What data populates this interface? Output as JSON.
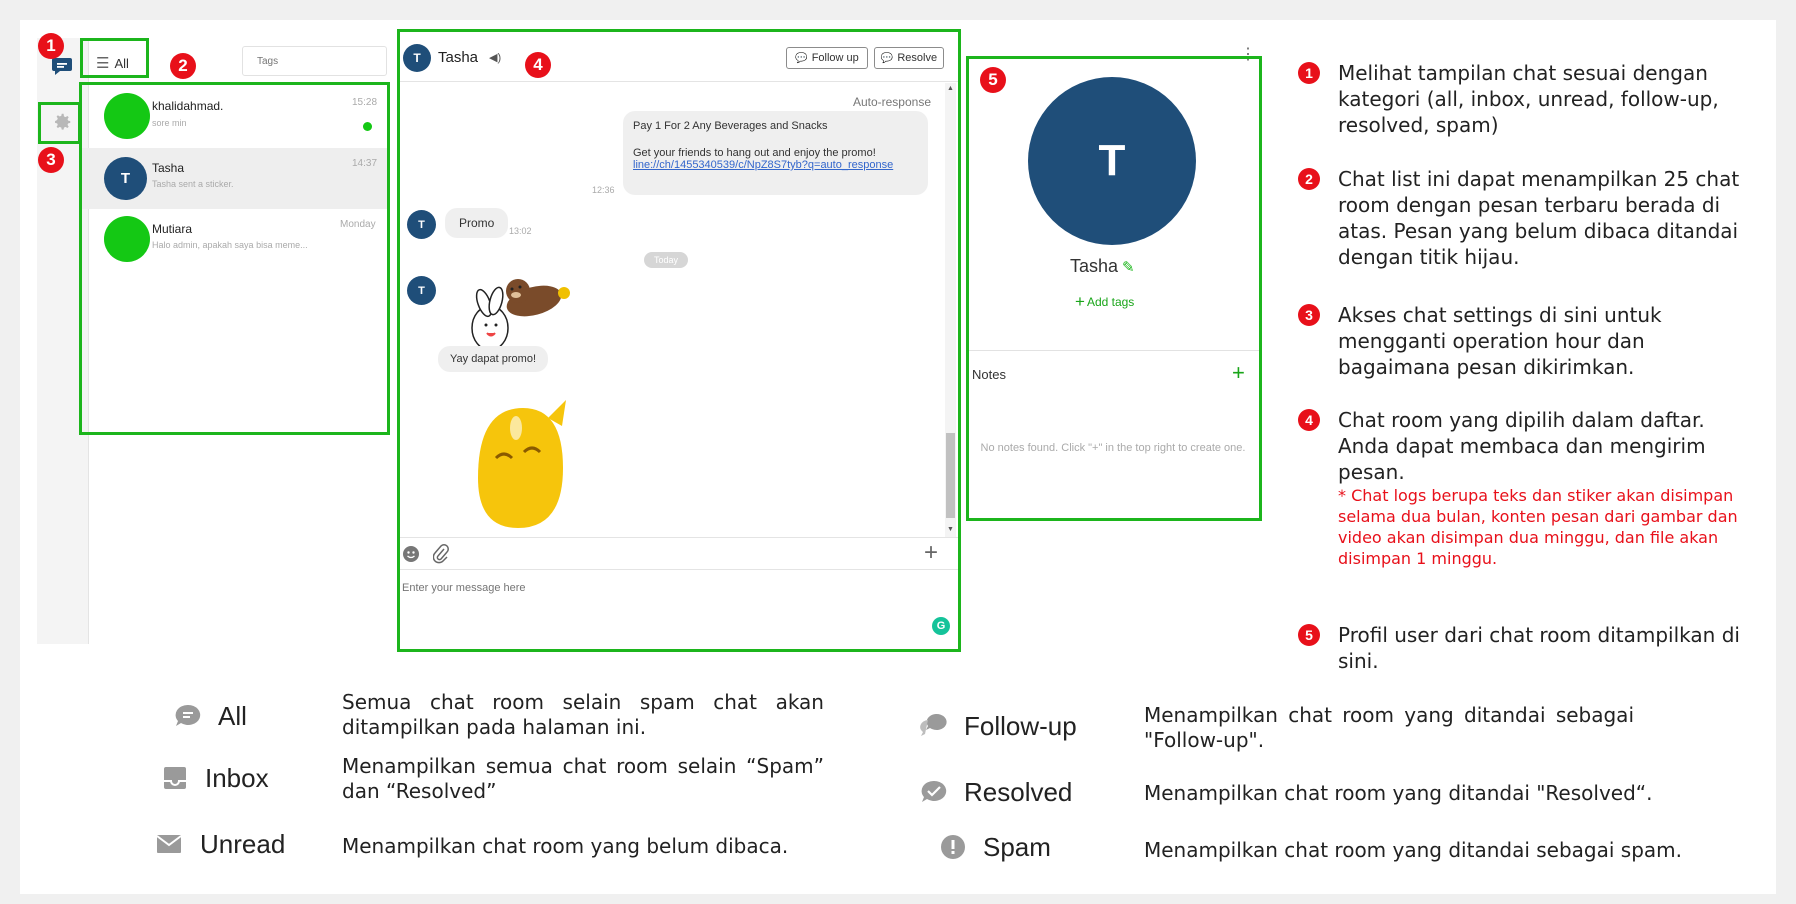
{
  "sidebar": {
    "filter_label": "All",
    "tags_placeholder": "Tags"
  },
  "chat_list": [
    {
      "name": "khalidahmad.",
      "preview": "sore min",
      "time": "15:28",
      "unread": true,
      "avatar": ""
    },
    {
      "name": "Tasha",
      "preview": "Tasha sent a sticker.",
      "time": "14:37",
      "unread": false,
      "avatar": "T"
    },
    {
      "name": "Mutiara",
      "preview": "Halo admin, apakah saya bisa meme...",
      "time": "Monday",
      "unread": false,
      "avatar": ""
    }
  ],
  "chat_room": {
    "avatar": "T",
    "contact_name": "Tasha",
    "follow_up_label": "Follow up",
    "resolve_label": "Resolve",
    "auto_response_label": "Auto-response",
    "promo_title": "Pay 1 For 2 Any Beverages and Snacks",
    "promo_body": "Get your friends to hang out and enjoy the promo!",
    "promo_link": "line://ch/1455340539/c/NpZ8S7tyb?q=auto_response",
    "promo_time": "12:36",
    "user_msg": "Promo",
    "user_msg_time": "13:02",
    "date_chip": "Today",
    "reply_msg": "Yay dapat promo!",
    "input_placeholder": "Enter your message here"
  },
  "profile": {
    "avatar": "T",
    "name": "Tasha",
    "add_tags": "Add tags",
    "notes_title": "Notes",
    "notes_empty": "No notes found. Click \"+\" in the top right to create one."
  },
  "badges": [
    "1",
    "2",
    "3",
    "4",
    "5"
  ],
  "annotations": [
    {
      "num": "1",
      "text": "Melihat tampilan chat sesuai dengan kategori (all, inbox, unread, follow-up, resolved, spam)"
    },
    {
      "num": "2",
      "text": "Chat list ini dapat menampilkan 25 chat room dengan pesan terbaru berada di atas. Pesan yang belum dibaca ditandai dengan titik hijau."
    },
    {
      "num": "3",
      "text": "Akses chat settings di sini untuk mengganti operation hour dan bagaimana pesan dikirimkan."
    },
    {
      "num": "4",
      "text": "Chat room yang dipilih dalam daftar. Anda dapat membaca dan mengirim pesan.",
      "note": "* Chat logs berupa teks dan stiker akan disimpan selama dua bulan, konten pesan dari gambar dan video akan disimpan dua minggu, dan file akan disimpan 1 minggu."
    },
    {
      "num": "5",
      "text": "Profil user dari chat room ditampilkan di sini."
    }
  ],
  "legend": [
    {
      "icon": "chat-bubble-icon",
      "label": "All",
      "desc": "Semua chat room selain spam chat akan ditampilkan pada halaman ini."
    },
    {
      "icon": "inbox-icon",
      "label": "Inbox",
      "desc": "Menampilkan semua chat room selain “Spam” dan “Resolved”"
    },
    {
      "icon": "envelope-icon",
      "label": "Unread",
      "desc": "Menampilkan chat room yang belum dibaca."
    },
    {
      "icon": "follow-up-icon",
      "label": "Follow-up",
      "desc": "Menampilkan chat room yang ditandai sebagai \"Follow-up\"."
    },
    {
      "icon": "resolved-icon",
      "label": "Resolved",
      "desc": "Menampilkan chat room yang ditandai \"Resolved“."
    },
    {
      "icon": "spam-icon",
      "label": "Spam",
      "desc": "Menampilkan chat room yang ditandai sebagai spam."
    }
  ],
  "colors": {
    "highlight": "#1cb51c",
    "badge": "#e8101a",
    "avatar": "#1f4e79",
    "unread_dot": "#14c814",
    "link": "#3366cc"
  }
}
